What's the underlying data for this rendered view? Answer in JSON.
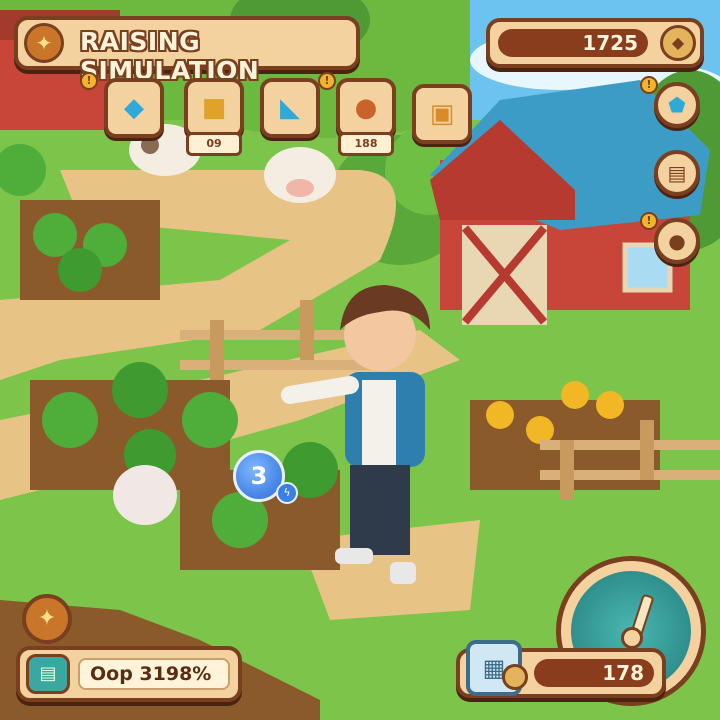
{
  "hud": {
    "title": "RAISING SIMULATION",
    "coins": "1725",
    "level": "3",
    "bottom_left_text": "Oop 3198%",
    "bottom_right_value": "178"
  },
  "inventory": [
    {
      "icon": "blue-gem-icon",
      "count": ""
    },
    {
      "icon": "hay-bale-icon",
      "count": "09"
    },
    {
      "icon": "blue-fish-icon",
      "count": ""
    },
    {
      "icon": "seed-bag-icon",
      "count": "188"
    },
    {
      "icon": "treasure-chest-icon",
      "count": ""
    }
  ],
  "side_buttons": [
    {
      "icon": "blue-shield-icon"
    },
    {
      "icon": "basket-icon"
    },
    {
      "icon": "coin-bag-icon"
    }
  ],
  "colors": {
    "panel": "#f3d2a0",
    "border": "#7a3f1f",
    "grass": "#7cc44a",
    "sky": "#6cc3f0",
    "barn_red": "#c8453a",
    "barn_roof": "#3c9cc6",
    "level_badge": "#2a6ad8"
  }
}
